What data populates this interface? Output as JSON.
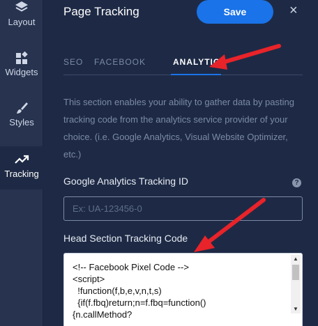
{
  "rail": {
    "items": [
      {
        "label": "Layout",
        "icon": "layers-icon"
      },
      {
        "label": "Widgets",
        "icon": "widgets-icon"
      },
      {
        "label": "Styles",
        "icon": "brush-icon"
      },
      {
        "label": "Tracking",
        "icon": "trending-icon",
        "active": true
      }
    ]
  },
  "header": {
    "title": "Page Tracking",
    "save_label": "Save",
    "close_glyph": "×"
  },
  "tabs": [
    {
      "label": "SEO"
    },
    {
      "label": "FACEBOOK"
    },
    {
      "label": "ANALYTICS",
      "active": true
    }
  ],
  "description": "This section enables your ability to gather data by pasting tracking code from the analytics service provider of your choice. (i.e. Google Analytics, Visual Website Optimizer, etc.)",
  "ga_field": {
    "label": "Google Analytics Tracking ID",
    "placeholder": "Ex: UA-123456-0",
    "value": "",
    "help_glyph": "?"
  },
  "head_code": {
    "label": "Head Section Tracking Code",
    "lines": [
      "<!-- Facebook Pixel Code -->",
      "<script>",
      "  !function(f,b,e,v,n,t,s)",
      "  {if(f.fbq)return;n=f.fbq=function()",
      "{n.callMethod?"
    ]
  },
  "colors": {
    "accent": "#1a73e8",
    "background": "#1e2a45",
    "annotation_arrow": "#e8232a"
  }
}
